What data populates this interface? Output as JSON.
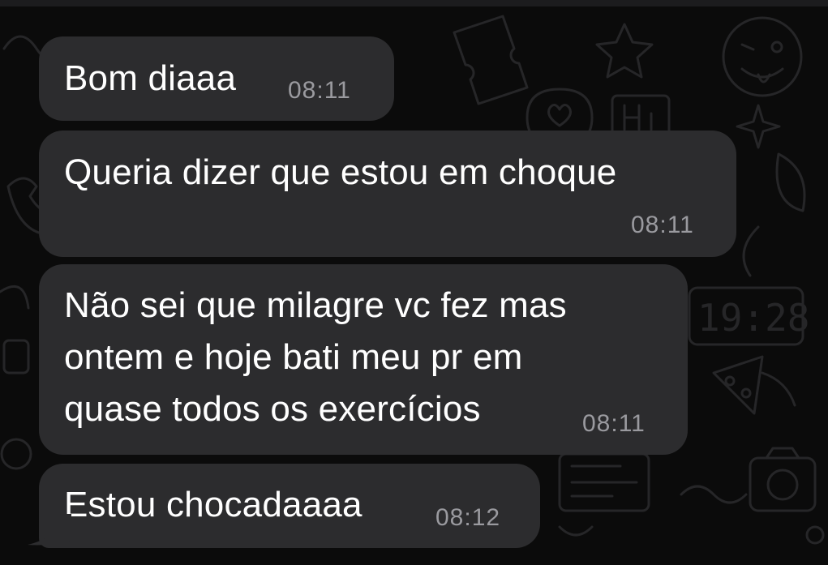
{
  "background": {
    "color": "#0b0b0b",
    "doodle_color": "#262628",
    "doodle_icons": [
      "ticket-icon",
      "star-icon",
      "wink-face-icon",
      "heart-icon",
      "hi-sign-icon",
      "sparkle-icon",
      "phone-icon",
      "clock-icon",
      "camera-icon",
      "leaf-icon",
      "pizza-icon"
    ]
  },
  "colors": {
    "bubble": "#2c2c2e",
    "text": "#ffffff",
    "time": "#9a9a9f"
  },
  "clock_doodle": {
    "text": "19:28"
  },
  "messages": [
    {
      "text": "Bom diaaa",
      "time": "08:11"
    },
    {
      "text": "Queria dizer que estou em choque",
      "time": "08:11"
    },
    {
      "lines": [
        "Não sei que milagre vc fez mas",
        "ontem e hoje bati meu pr em",
        "quase todos os exercícios"
      ],
      "time": "08:11"
    },
    {
      "text": "Estou chocadaaaa",
      "time": "08:12"
    }
  ]
}
